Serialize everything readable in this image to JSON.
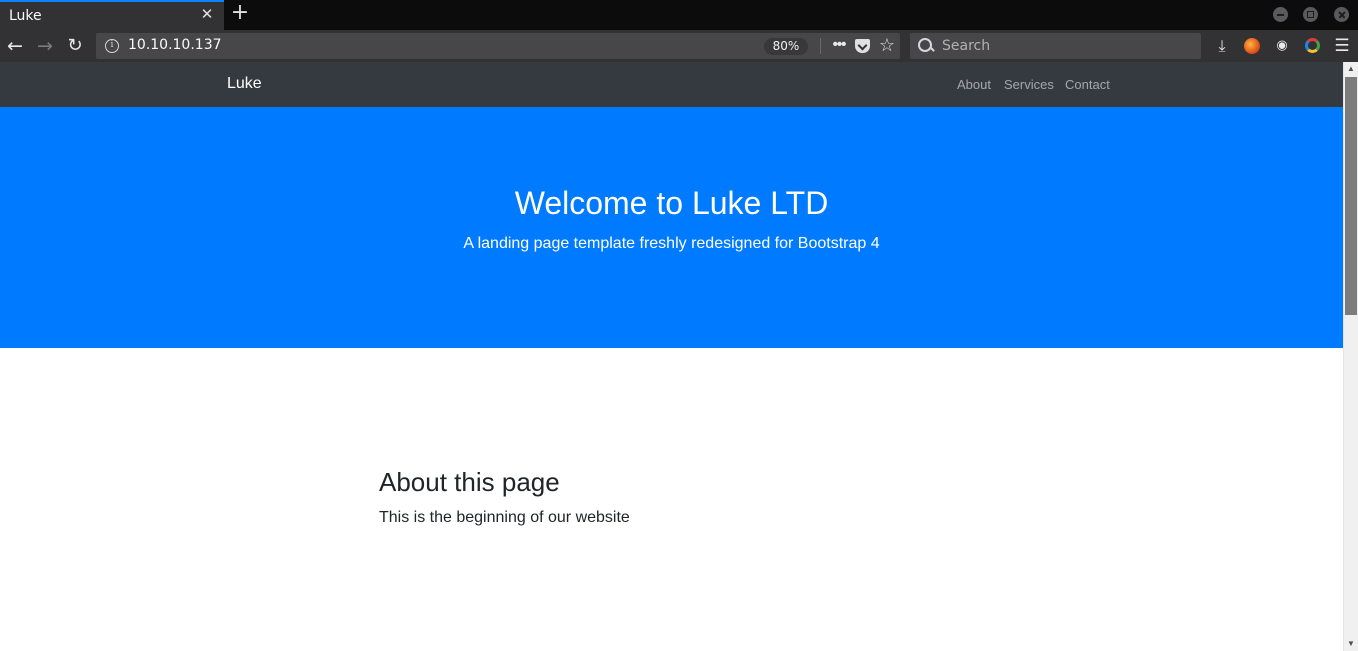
{
  "browser": {
    "tab_title": "Luke",
    "tab_close_glyph": "✕",
    "new_tab_glyph": "+",
    "url": "10.10.10.137",
    "zoom": "80%",
    "search_placeholder": "Search",
    "accent_color": "#0a84ff",
    "icons": [
      "back-icon",
      "forward-icon",
      "reload-icon",
      "info-icon",
      "page-actions-icon",
      "pocket-icon",
      "bookmark-star-icon",
      "search-icon",
      "download-icon",
      "extension-icon",
      "menu-icon"
    ]
  },
  "site": {
    "brand": "Luke",
    "nav_links": [
      "About",
      "Services",
      "Contact"
    ],
    "hero": {
      "title": "Welcome to Luke LTD",
      "subtitle": "A landing page template freshly redesigned for Bootstrap 4",
      "background": "#007bff"
    },
    "about": {
      "title": "About this page",
      "text": "This is the beginning of our website"
    },
    "navbar_color": "#343a40"
  }
}
